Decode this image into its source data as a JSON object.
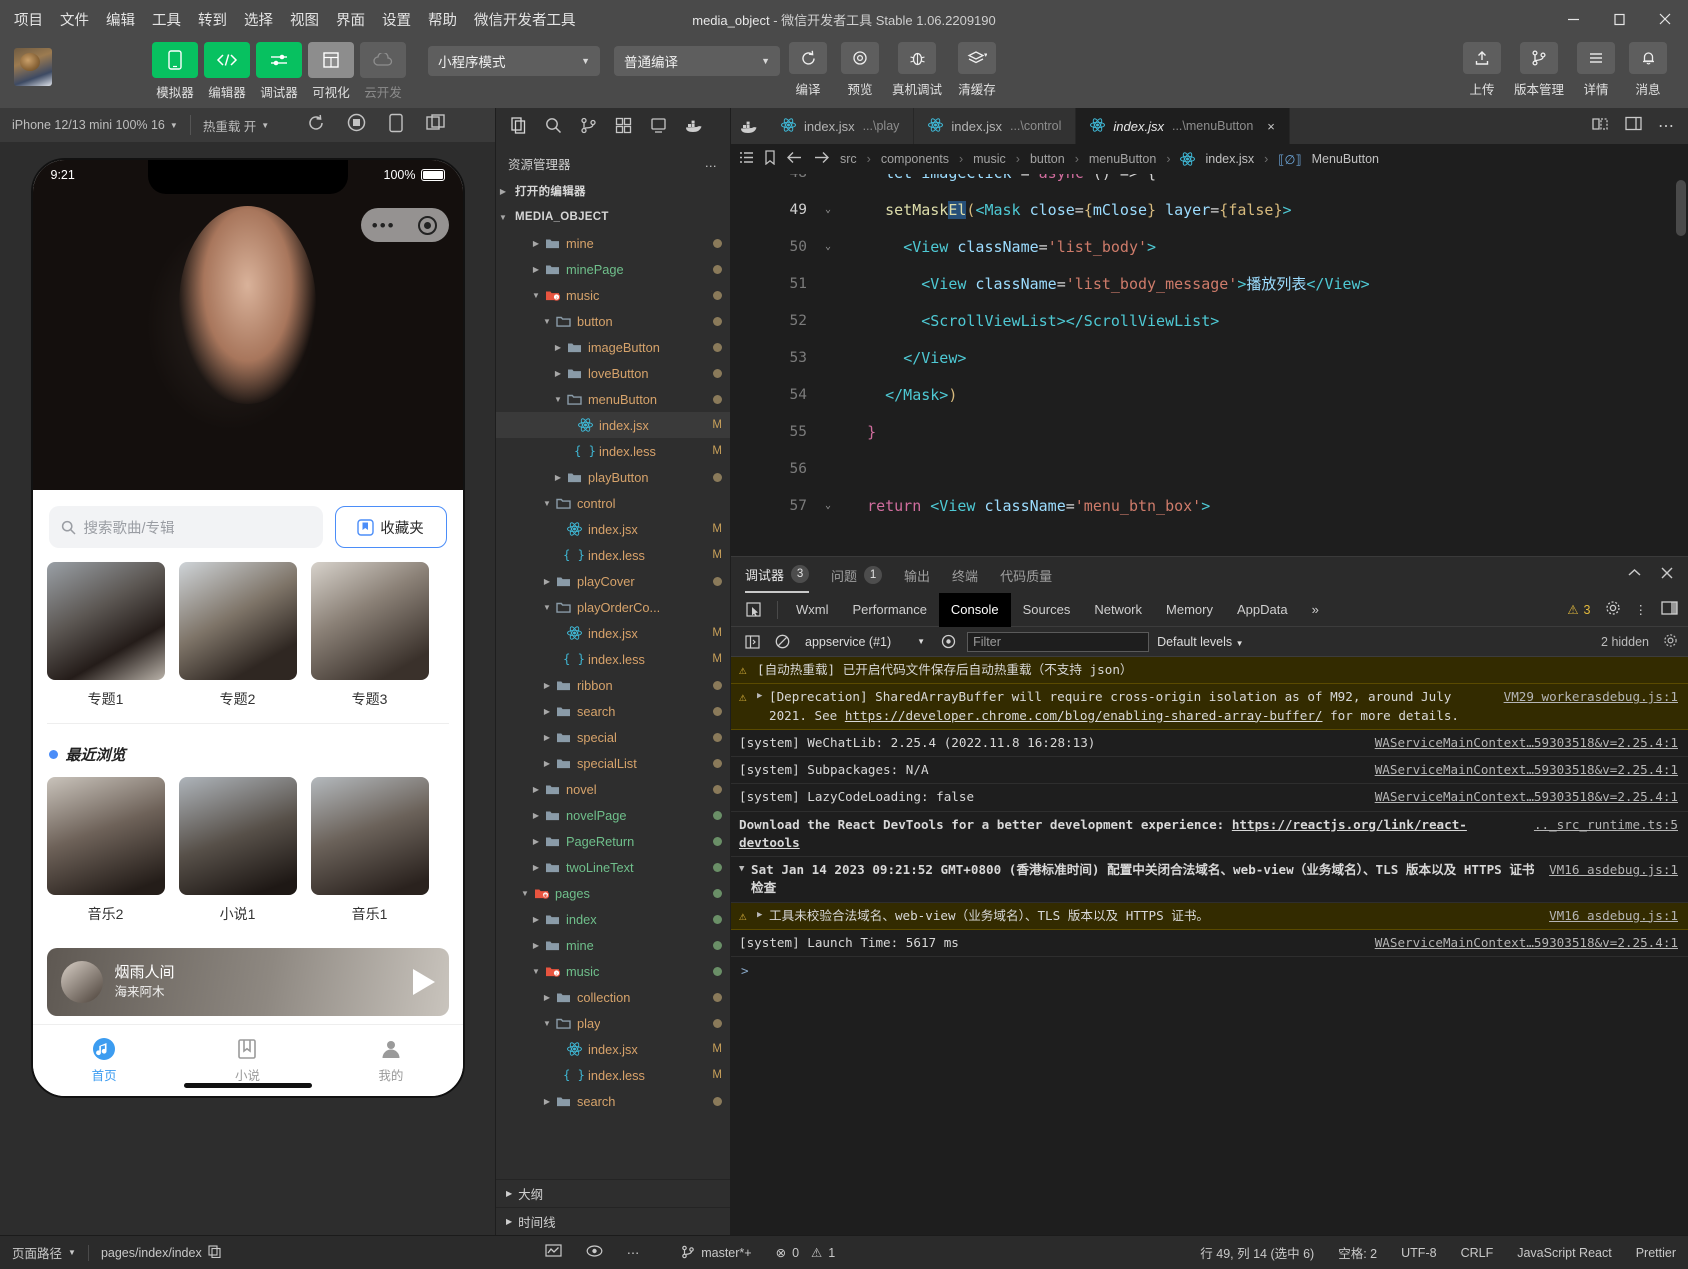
{
  "titlebar": {
    "menus": [
      "项目",
      "文件",
      "编辑",
      "工具",
      "转到",
      "选择",
      "视图",
      "界面",
      "设置",
      "帮助",
      "微信开发者工具"
    ],
    "project_name": "media_object",
    "app_title": "微信开发者工具 Stable 1.06.2209190",
    "separator": " - ",
    "minimize": "minimize-button",
    "maximize": "maximize-button",
    "close": "close-button"
  },
  "toolbar": {
    "buttons": [
      {
        "label": "模拟器",
        "icon": "phone-icon",
        "state": "active"
      },
      {
        "label": "编辑器",
        "icon": "code-icon",
        "state": "active"
      },
      {
        "label": "调试器",
        "icon": "sliders-icon",
        "state": "active"
      },
      {
        "label": "可视化",
        "icon": "layout-icon",
        "state": "grey"
      },
      {
        "label": "云开发",
        "icon": "cloud-icon",
        "state": "disabled"
      }
    ],
    "mode_select": "小程序模式",
    "compile_select": "普通编译",
    "actions": [
      {
        "label": "编译",
        "icon": "refresh-icon"
      },
      {
        "label": "预览",
        "icon": "eye-icon"
      },
      {
        "label": "真机调试",
        "icon": "bug-icon"
      },
      {
        "label": "清缓存",
        "icon": "layers-icon"
      }
    ],
    "right_actions": [
      {
        "label": "上传",
        "icon": "upload-icon"
      },
      {
        "label": "版本管理",
        "icon": "git-branch-icon"
      },
      {
        "label": "详情",
        "icon": "menu-lines-icon"
      },
      {
        "label": "消息",
        "icon": "bell-icon"
      }
    ]
  },
  "simulator": {
    "device": "iPhone 12/13 mini 100% 16",
    "hotreload": "热重载 开",
    "icons": [
      "refresh-icon",
      "record-icon",
      "rotate-device-icon",
      "split-screen-icon"
    ],
    "phone": {
      "status_time": "9:21",
      "status_battery": "100%",
      "search_placeholder": "搜索歌曲/专辑",
      "fav_label": "收藏夹",
      "top_cards": [
        {
          "caption": "专题1"
        },
        {
          "caption": "专题2"
        },
        {
          "caption": "专题3"
        }
      ],
      "section_title": "最近浏览",
      "recent_cards": [
        {
          "caption": "音乐2"
        },
        {
          "caption": "小说1"
        },
        {
          "caption": "音乐1"
        }
      ],
      "player": {
        "song": "烟雨人间",
        "artist": "海来阿木"
      },
      "tabs": [
        {
          "label": "首页",
          "icon": "music-note-icon",
          "active": true
        },
        {
          "label": "小说",
          "icon": "book-icon",
          "active": false
        },
        {
          "label": "我的",
          "icon": "person-icon",
          "active": false
        }
      ]
    }
  },
  "explorer": {
    "action_icons": [
      "files-icon",
      "search-icon",
      "source-control-icon",
      "extensions-icon",
      "debug-icon",
      "docker-icon"
    ],
    "title": "资源管理器",
    "more": "…",
    "open_editors": "打开的编辑器",
    "root": "MEDIA_OBJECT",
    "tree": [
      {
        "label": "mine",
        "depth": 3,
        "type": "folder",
        "expanded": false,
        "color": "orange",
        "git": "dot"
      },
      {
        "label": "minePage",
        "depth": 3,
        "type": "folder",
        "expanded": false,
        "color": "green",
        "git": "dot"
      },
      {
        "label": "music",
        "depth": 3,
        "type": "folder-music",
        "expanded": true,
        "color": "orange",
        "git": "dot"
      },
      {
        "label": "button",
        "depth": 4,
        "type": "folder-open",
        "expanded": true,
        "color": "orange",
        "git": "dot"
      },
      {
        "label": "imageButton",
        "depth": 5,
        "type": "folder",
        "expanded": false,
        "color": "orange",
        "git": "dot"
      },
      {
        "label": "loveButton",
        "depth": 5,
        "type": "folder",
        "expanded": false,
        "color": "orange",
        "git": "dot"
      },
      {
        "label": "menuButton",
        "depth": 5,
        "type": "folder-open",
        "expanded": true,
        "color": "orange",
        "git": "dot"
      },
      {
        "label": "index.jsx",
        "depth": 6,
        "type": "jsx",
        "selected": true,
        "badge": "M"
      },
      {
        "label": "index.less",
        "depth": 6,
        "type": "less",
        "badge": "M"
      },
      {
        "label": "playButton",
        "depth": 5,
        "type": "folder",
        "expanded": false,
        "color": "orange",
        "git": "dot"
      },
      {
        "label": "control",
        "depth": 4,
        "type": "folder-open",
        "expanded": true,
        "color": "orange"
      },
      {
        "label": "index.jsx",
        "depth": 5,
        "type": "jsx",
        "badge": "M"
      },
      {
        "label": "index.less",
        "depth": 5,
        "type": "less",
        "badge": "M"
      },
      {
        "label": "playCover",
        "depth": 4,
        "type": "folder",
        "expanded": false,
        "color": "orange",
        "git": "dot"
      },
      {
        "label": "playOrderCo...",
        "depth": 4,
        "type": "folder-open",
        "expanded": true,
        "color": "orange"
      },
      {
        "label": "index.jsx",
        "depth": 5,
        "type": "jsx",
        "badge": "M"
      },
      {
        "label": "index.less",
        "depth": 5,
        "type": "less",
        "badge": "M"
      },
      {
        "label": "ribbon",
        "depth": 4,
        "type": "folder",
        "expanded": false,
        "color": "orange",
        "git": "dot"
      },
      {
        "label": "search",
        "depth": 4,
        "type": "folder",
        "expanded": false,
        "color": "orange",
        "git": "dot"
      },
      {
        "label": "special",
        "depth": 4,
        "type": "folder",
        "expanded": false,
        "color": "orange",
        "git": "dot"
      },
      {
        "label": "specialList",
        "depth": 4,
        "type": "folder",
        "expanded": false,
        "color": "orange",
        "git": "dot"
      },
      {
        "label": "novel",
        "depth": 3,
        "type": "folder",
        "expanded": false,
        "color": "orange",
        "git": "dot"
      },
      {
        "label": "novelPage",
        "depth": 3,
        "type": "folder",
        "expanded": false,
        "color": "green",
        "git": "dot-green"
      },
      {
        "label": "PageReturn",
        "depth": 3,
        "type": "folder",
        "expanded": false,
        "color": "green",
        "git": "dot-green"
      },
      {
        "label": "twoLineText",
        "depth": 3,
        "type": "folder",
        "expanded": false,
        "color": "green",
        "git": "dot-green"
      },
      {
        "label": "pages",
        "depth": 2,
        "type": "folder-pages",
        "expanded": true,
        "color": "green",
        "git": "dot-green"
      },
      {
        "label": "index",
        "depth": 3,
        "type": "folder",
        "expanded": false,
        "color": "green",
        "git": "dot-green"
      },
      {
        "label": "mine",
        "depth": 3,
        "type": "folder",
        "expanded": false,
        "color": "green",
        "git": "dot-green"
      },
      {
        "label": "music",
        "depth": 3,
        "type": "folder-music",
        "expanded": true,
        "color": "green",
        "git": "dot-green"
      },
      {
        "label": "collection",
        "depth": 4,
        "type": "folder",
        "expanded": false,
        "color": "orange",
        "git": "dot"
      },
      {
        "label": "play",
        "depth": 4,
        "type": "folder-open",
        "expanded": true,
        "color": "orange",
        "git": "dot"
      },
      {
        "label": "index.jsx",
        "depth": 5,
        "type": "jsx",
        "badge": "M"
      },
      {
        "label": "index.less",
        "depth": 5,
        "type": "less",
        "badge": "M"
      },
      {
        "label": "search",
        "depth": 4,
        "type": "folder",
        "expanded": false,
        "color": "orange",
        "git": "dot"
      }
    ],
    "footer": [
      "大纲",
      "时间线"
    ]
  },
  "editor": {
    "tabs": [
      {
        "name": "index.jsx",
        "path": "...\\play",
        "active": false,
        "icon": "react-icon"
      },
      {
        "name": "index.jsx",
        "path": "...\\control",
        "active": false,
        "icon": "react-icon"
      },
      {
        "name": "index.jsx",
        "path": "...\\menuButton",
        "active": true,
        "icon": "react-icon",
        "close": "×"
      }
    ],
    "tab_actions": [
      "split-editor-icon",
      "layout-panel-icon",
      "more-icon"
    ],
    "breadcrumb": {
      "icons": [
        "outline-icon",
        "bookmark-icon",
        "back-icon",
        "forward-icon"
      ],
      "parts": [
        "src",
        "components",
        "music",
        "button",
        "menuButton",
        "index.jsx",
        "MenuButton"
      ],
      "separator": "›"
    },
    "lines": [
      {
        "no": "48",
        "fold": "",
        "partial_top": true,
        "tokens": [
          {
            "t": "    ",
            "c": "k-white"
          },
          {
            "t": "let imageClick",
            "c": "k-attr"
          },
          {
            "t": " = ",
            "c": "k-white"
          },
          {
            "t": "async",
            "c": "k-pink"
          },
          {
            "t": " () => {",
            "c": "k-white"
          }
        ]
      },
      {
        "no": "49",
        "fold": "⌄",
        "current": true,
        "tokens": [
          {
            "t": "    ",
            "c": "k-white"
          },
          {
            "t": "setMask",
            "c": "k-fn"
          },
          {
            "t": "El",
            "c": "k-fn",
            "sel": true
          },
          {
            "t": "(",
            "c": "k-brace"
          },
          {
            "t": "<Mask",
            "c": "k-tag"
          },
          {
            "t": " close",
            "c": "k-attr"
          },
          {
            "t": "=",
            "c": "k-white"
          },
          {
            "t": "{",
            "c": "k-brace"
          },
          {
            "t": "mClose",
            "c": "k-attr"
          },
          {
            "t": "}",
            "c": "k-brace"
          },
          {
            "t": " layer",
            "c": "k-attr"
          },
          {
            "t": "=",
            "c": "k-white"
          },
          {
            "t": "{",
            "c": "k-brace"
          },
          {
            "t": "false",
            "c": "k-brace"
          },
          {
            "t": "}",
            "c": "k-brace"
          },
          {
            "t": ">",
            "c": "k-tag"
          }
        ]
      },
      {
        "no": "50",
        "fold": "⌄",
        "tokens": [
          {
            "t": "      ",
            "c": "k-white"
          },
          {
            "t": "<View",
            "c": "k-tag"
          },
          {
            "t": " className",
            "c": "k-attr"
          },
          {
            "t": "=",
            "c": "k-white"
          },
          {
            "t": "'list_body'",
            "c": "k-str"
          },
          {
            "t": ">",
            "c": "k-tag"
          }
        ]
      },
      {
        "no": "51",
        "fold": "",
        "tokens": [
          {
            "t": "        ",
            "c": "k-white"
          },
          {
            "t": "<View",
            "c": "k-tag"
          },
          {
            "t": " className",
            "c": "k-attr"
          },
          {
            "t": "=",
            "c": "k-white"
          },
          {
            "t": "'list_body_message'",
            "c": "k-str"
          },
          {
            "t": ">",
            "c": "k-tag"
          },
          {
            "t": "播放列表",
            "c": "k-cn"
          },
          {
            "t": "</View>",
            "c": "k-tag"
          }
        ]
      },
      {
        "no": "52",
        "fold": "",
        "tokens": [
          {
            "t": "        ",
            "c": "k-white"
          },
          {
            "t": "<ScrollViewList></ScrollViewList>",
            "c": "k-tag"
          }
        ]
      },
      {
        "no": "53",
        "fold": "",
        "tokens": [
          {
            "t": "      ",
            "c": "k-white"
          },
          {
            "t": "</View>",
            "c": "k-tag"
          }
        ]
      },
      {
        "no": "54",
        "fold": "",
        "tokens": [
          {
            "t": "    ",
            "c": "k-white"
          },
          {
            "t": "</Mask>",
            "c": "k-tag"
          },
          {
            "t": ")",
            "c": "k-brace"
          }
        ]
      },
      {
        "no": "55",
        "fold": "",
        "tokens": [
          {
            "t": "  ",
            "c": "k-white"
          },
          {
            "t": "}",
            "c": "k-pink"
          }
        ]
      },
      {
        "no": "56",
        "fold": "",
        "tokens": []
      },
      {
        "no": "57",
        "fold": "⌄",
        "partial_bottom": true,
        "tokens": [
          {
            "t": "  ",
            "c": "k-white"
          },
          {
            "t": "return",
            "c": "k-pink"
          },
          {
            "t": " ",
            "c": "k-white"
          },
          {
            "t": "<View",
            "c": "k-tag"
          },
          {
            "t": " className",
            "c": "k-attr"
          },
          {
            "t": "=",
            "c": "k-white"
          },
          {
            "t": "'menu_btn_box'",
            "c": "k-str"
          },
          {
            "t": ">",
            "c": "k-tag"
          }
        ]
      }
    ]
  },
  "debugger": {
    "panel_tabs": [
      {
        "label": "调试器",
        "count": "3",
        "active": true
      },
      {
        "label": "问题",
        "count": "1",
        "active": false
      },
      {
        "label": "输出",
        "active": false
      },
      {
        "label": "终端",
        "active": false
      },
      {
        "label": "代码质量",
        "active": false
      }
    ],
    "panel_actions": [
      "chevron-up-icon",
      "close-icon"
    ],
    "devtools_tabs": [
      "Wxml",
      "Performance",
      "Console",
      "Sources",
      "Network",
      "Memory",
      "AppData"
    ],
    "devtools_active": "Console",
    "overflow": "»",
    "warn_count": "3",
    "right_icons": [
      "gear-icon",
      "kebab-icon",
      "dock-icon"
    ],
    "filterbar": {
      "sidebar_icon": "sidebar-toggle-icon",
      "clear_icon": "clear-console-icon",
      "context": "appservice (#1)",
      "eye_icon": "eye-icon",
      "filter_placeholder": "Filter",
      "levels": "Default levels",
      "hidden": "2 hidden",
      "settings_icon": "settings-icon"
    },
    "messages": [
      {
        "kind": "warn",
        "icon": "warning-icon",
        "text": "[自动热重载] 已开启代码文件保存后自动热重载（不支持 json）",
        "source": ""
      },
      {
        "kind": "warn",
        "icon": "warning-icon",
        "expandable": true,
        "text": "[Deprecation] SharedArrayBuffer will require cross-origin isolation as of M92, around July 2021. See https://developer.chrome.com/blog/enabling-shared-array-buffer/ for more details.",
        "link": "https://developer.chrome.com/blog/enabling-shared-array-buffer/",
        "source": "VM29 workerasdebug.js:1"
      },
      {
        "kind": "info",
        "text": "[system] WeChatLib: 2.25.4 (2022.11.8 16:28:13)",
        "source": "WAServiceMainContext…59303518&v=2.25.4:1"
      },
      {
        "kind": "info",
        "text": "[system] Subpackages: N/A",
        "source": "WAServiceMainContext…59303518&v=2.25.4:1"
      },
      {
        "kind": "info",
        "text": "[system] LazyCodeLoading: false",
        "source": "WAServiceMainContext…59303518&v=2.25.4:1"
      },
      {
        "kind": "info",
        "bold": true,
        "text": "Download the React DevTools for a better development experience: https://reactjs.org/link/react-devtools",
        "link": "https://reactjs.org/link/react-devtools",
        "source": ".._src_runtime.ts:5"
      },
      {
        "kind": "group",
        "expandable": true,
        "bold": true,
        "text": "Sat Jan 14 2023 09:21:52 GMT+0800 (香港标准时间) 配置中关闭合法域名、web-view（业务域名）、TLS 版本以及 HTTPS 证书检查",
        "source": "VM16 asdebug.js:1"
      },
      {
        "kind": "warn",
        "icon": "warning-icon",
        "expandable": true,
        "text": "工具未校验合法域名、web-view（业务域名）、TLS 版本以及 HTTPS 证书。",
        "source": "VM16 asdebug.js:1"
      },
      {
        "kind": "info",
        "text": "[system] Launch Time: 5617 ms",
        "source": "WAServiceMainContext…59303518&v=2.25.4:1"
      }
    ],
    "prompt": ">"
  },
  "statusbar": {
    "page_path_label": "页面路径",
    "page_path_value": "pages/index/index",
    "copy_icon": "copy-icon",
    "sim_icons": [
      "perf-icon",
      "eye-icon",
      "more-icon"
    ],
    "branch": "master*+",
    "errors": "0",
    "warnings": "1",
    "cursor": "行 49, 列 14 (选中 6)",
    "indent": "空格: 2",
    "encoding": "UTF-8",
    "eol": "CRLF",
    "language": "JavaScript React",
    "formatter": "Prettier"
  }
}
